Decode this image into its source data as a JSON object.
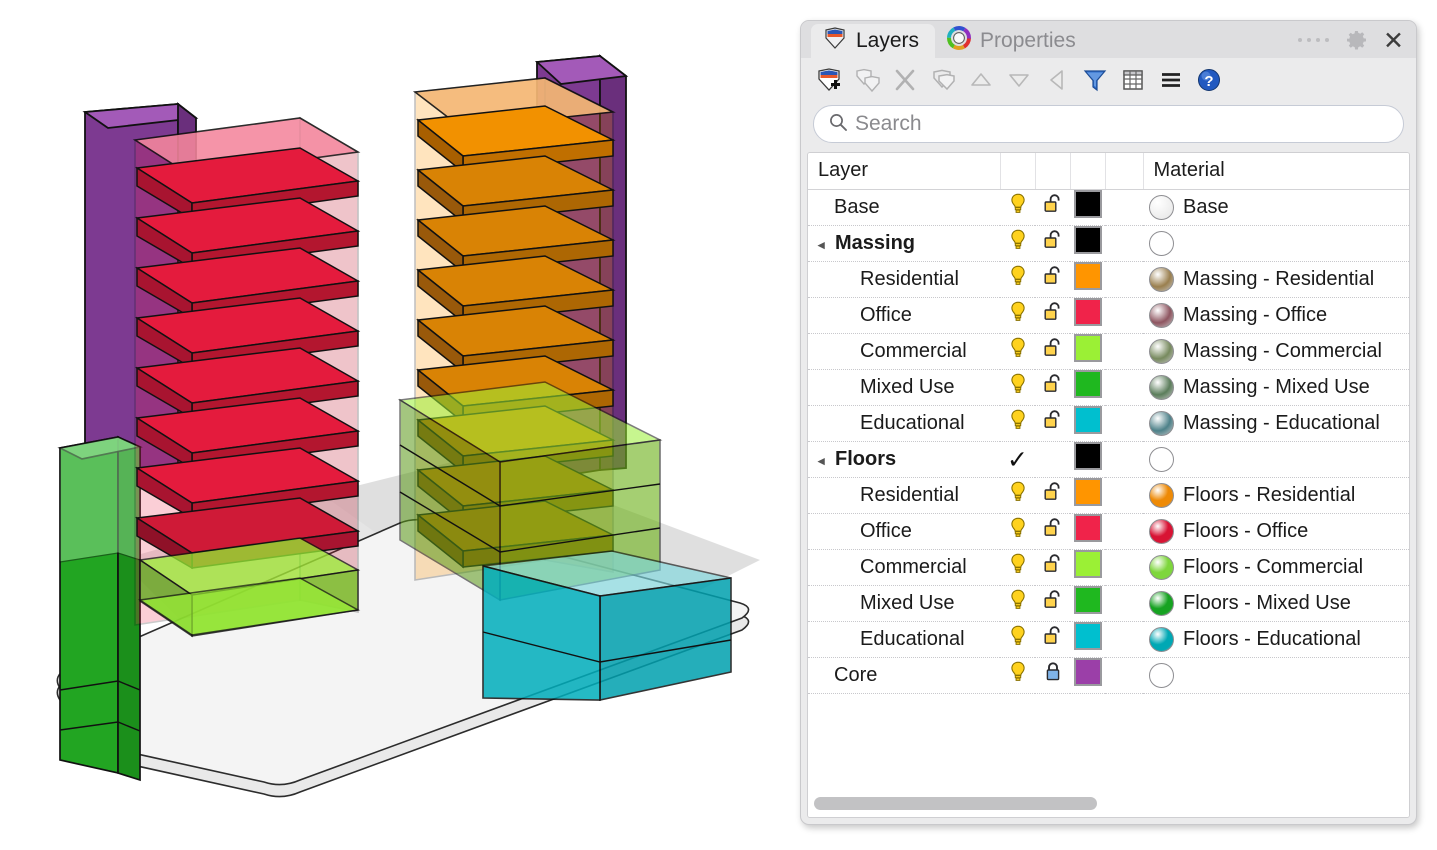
{
  "panel": {
    "tabs": [
      {
        "label": "Layers",
        "icon": "layers-icon",
        "active": true
      },
      {
        "label": "Properties",
        "icon": "color-wheel-icon",
        "active": false
      }
    ],
    "window_controls": {
      "drag_dots": "drag-dots",
      "settings_label": "gear-icon",
      "close_label": "✕"
    },
    "toolbar": [
      {
        "name": "new-layer-icon",
        "enabled": true
      },
      {
        "name": "duplicate-layer-icon",
        "enabled": false
      },
      {
        "name": "delete-layer-icon",
        "enabled": false
      },
      {
        "name": "new-sublayer-icon",
        "enabled": false
      },
      {
        "name": "move-up-icon",
        "enabled": false
      },
      {
        "name": "move-down-icon",
        "enabled": false
      },
      {
        "name": "move-left-icon",
        "enabled": false
      },
      {
        "name": "filter-icon",
        "enabled": true
      },
      {
        "name": "grid-icon",
        "enabled": true
      },
      {
        "name": "menu-icon",
        "enabled": true
      },
      {
        "name": "help-icon",
        "enabled": true
      }
    ],
    "search": {
      "placeholder": "Search",
      "value": "",
      "icon": "search-icon"
    },
    "columns": {
      "layer": "Layer",
      "material": "Material"
    },
    "scrollbar": {
      "thumb_percent": 48
    }
  },
  "rows": [
    {
      "name": "Base",
      "indent": 0,
      "group": false,
      "bold": false,
      "twisty": "",
      "visible": true,
      "locked": false,
      "current": false,
      "color": "#000000",
      "material": "Base",
      "sphere": "#e6e6e6",
      "sphere_style": "empty"
    },
    {
      "name": "Massing",
      "indent": 0,
      "group": true,
      "bold": false,
      "twisty": "◂",
      "visible": true,
      "locked": false,
      "current": false,
      "color": "#000000",
      "material": "",
      "sphere": "#ffffff",
      "sphere_style": "empty"
    },
    {
      "name": "Residential",
      "indent": 1,
      "group": false,
      "bold": false,
      "twisty": "",
      "visible": true,
      "locked": false,
      "current": false,
      "color": "#FF9500",
      "material": "Massing - Residential",
      "sphere": "#9a7f4e",
      "sphere_style": "matte"
    },
    {
      "name": "Office",
      "indent": 1,
      "group": false,
      "bold": false,
      "twisty": "",
      "visible": true,
      "locked": false,
      "current": false,
      "color": "#F0234A",
      "material": "Massing - Office",
      "sphere": "#8e5560",
      "sphere_style": "matte"
    },
    {
      "name": "Commercial",
      "indent": 1,
      "group": false,
      "bold": false,
      "twisty": "",
      "visible": true,
      "locked": false,
      "current": false,
      "color": "#9BF035",
      "material": "Massing - Commercial",
      "sphere": "#778a5e",
      "sphere_style": "matte"
    },
    {
      "name": "Mixed Use",
      "indent": 1,
      "group": false,
      "bold": false,
      "twisty": "",
      "visible": true,
      "locked": false,
      "current": false,
      "color": "#1FB81F",
      "material": "Massing - Mixed Use",
      "sphere": "#5b7d5b",
      "sphere_style": "matte"
    },
    {
      "name": "Educational",
      "indent": 1,
      "group": false,
      "bold": false,
      "twisty": "",
      "visible": true,
      "locked": false,
      "current": false,
      "color": "#00BFCF",
      "material": "Massing - Educational",
      "sphere": "#4d8189",
      "sphere_style": "matte"
    },
    {
      "name": "Floors",
      "indent": 0,
      "group": true,
      "bold": true,
      "twisty": "◂",
      "visible": null,
      "locked": null,
      "current": true,
      "color": "#000000",
      "material": "",
      "sphere": "#ffffff",
      "sphere_style": "empty"
    },
    {
      "name": "Residential",
      "indent": 1,
      "group": false,
      "bold": false,
      "twisty": "",
      "visible": true,
      "locked": false,
      "current": false,
      "color": "#FF9500",
      "material": "Floors - Residential",
      "sphere": "#EE8A06",
      "sphere_style": "gloss"
    },
    {
      "name": "Office",
      "indent": 1,
      "group": false,
      "bold": false,
      "twisty": "",
      "visible": true,
      "locked": false,
      "current": false,
      "color": "#F0234A",
      "material": "Floors - Office",
      "sphere": "#D81334",
      "sphere_style": "gloss"
    },
    {
      "name": "Commercial",
      "indent": 1,
      "group": false,
      "bold": false,
      "twisty": "",
      "visible": true,
      "locked": false,
      "current": false,
      "color": "#9BF035",
      "material": "Floors - Commercial",
      "sphere": "#7ED63C",
      "sphere_style": "gloss"
    },
    {
      "name": "Mixed Use",
      "indent": 1,
      "group": false,
      "bold": false,
      "twisty": "",
      "visible": true,
      "locked": false,
      "current": false,
      "color": "#1FB81F",
      "material": "Floors - Mixed Use",
      "sphere": "#16A321",
      "sphere_style": "gloss"
    },
    {
      "name": "Educational",
      "indent": 1,
      "group": false,
      "bold": false,
      "twisty": "",
      "visible": true,
      "locked": false,
      "current": false,
      "color": "#00BFCF",
      "material": "Floors - Educational",
      "sphere": "#00A8B4",
      "sphere_style": "gloss"
    },
    {
      "name": "Core",
      "indent": 0,
      "group": false,
      "bold": false,
      "twisty": "",
      "visible": true,
      "locked": true,
      "current": false,
      "color": "#9B3FA8",
      "material": "",
      "sphere": "#ffffff",
      "sphere_style": "empty"
    }
  ],
  "viewport": {
    "scene_name": "massing-model-3d-view",
    "ground_color": "#e3e3e3",
    "volumes": [
      {
        "name": "office-tower",
        "color": "#F0234A",
        "floors": 9
      },
      {
        "name": "residential-tower",
        "color": "#FF9500",
        "floors": 9
      },
      {
        "name": "mixed-use-slab",
        "color": "#1FB81F",
        "floors": 3
      },
      {
        "name": "commercial-podium",
        "color": "#9BF035",
        "floors": 3
      },
      {
        "name": "educational-block",
        "color": "#00BFCF",
        "floors": 2
      },
      {
        "name": "core-left",
        "color": "#9B3FA8",
        "floors": 0
      },
      {
        "name": "core-right",
        "color": "#9B3FA8",
        "floors": 0
      }
    ]
  }
}
